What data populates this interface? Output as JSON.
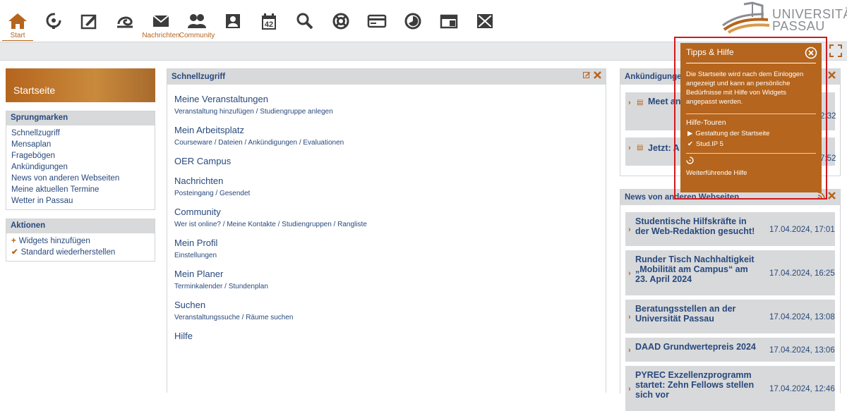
{
  "nav": {
    "items": [
      {
        "name": "start",
        "label": "Start",
        "icon": "home-icon"
      },
      {
        "name": "courses",
        "label": "",
        "icon": "seminar-icon"
      },
      {
        "name": "workplace",
        "label": "",
        "icon": "workplace-icon"
      },
      {
        "name": "oer",
        "label": "",
        "icon": "oer-icon"
      },
      {
        "name": "messages",
        "label": "Nachrichten",
        "icon": "mail-icon"
      },
      {
        "name": "community",
        "label": "Community",
        "icon": "community-icon"
      },
      {
        "name": "profile",
        "label": "",
        "icon": "person-icon"
      },
      {
        "name": "planer",
        "label": "",
        "icon": "calendar-icon"
      },
      {
        "name": "search",
        "label": "",
        "icon": "search-icon"
      },
      {
        "name": "tools",
        "label": "",
        "icon": "lifebuoy-icon"
      },
      {
        "name": "card",
        "label": "",
        "icon": "card-icon"
      },
      {
        "name": "stats",
        "label": "",
        "icon": "pie-icon"
      },
      {
        "name": "admin",
        "label": "",
        "icon": "window-icon"
      },
      {
        "name": "blubber",
        "label": "",
        "icon": "blocked-icon"
      }
    ],
    "calendar_day": "42"
  },
  "logo": {
    "line1": "UNIVERSITÄT",
    "line2": "PASSAU"
  },
  "sidebar": {
    "start_label": "Startseite",
    "jump_title": "Sprungmarken",
    "jump_items": [
      "Schnellzugriff",
      "Mensaplan",
      "Fragebögen",
      "Ankündigungen",
      "News von anderen Webseiten",
      "Meine aktuellen Termine",
      "Wetter in Passau"
    ],
    "actions_title": "Aktionen",
    "actions": [
      "Widgets hinzufügen",
      "Standard wiederherstellen"
    ]
  },
  "quick": {
    "title": "Schnellzugriff",
    "sections": [
      {
        "t": "Meine Veranstaltungen",
        "links": [
          "Veranstaltung hinzufügen",
          "Studiengruppe anlegen"
        ]
      },
      {
        "t": "Mein Arbeitsplatz",
        "links": [
          "Courseware",
          "Dateien",
          "Ankündigungen",
          "Evaluationen"
        ]
      },
      {
        "t": "OER Campus",
        "links": []
      },
      {
        "t": "Nachrichten",
        "links": [
          "Posteingang",
          "Gesendet"
        ]
      },
      {
        "t": "Community",
        "links": [
          "Wer ist online?",
          "Meine Kontakte",
          "Studiengruppen",
          "Rangliste"
        ]
      },
      {
        "t": "Mein Profil",
        "links": [
          "Einstellungen"
        ]
      },
      {
        "t": "Mein Planer",
        "links": [
          "Terminkalender",
          "Stundenplan"
        ]
      },
      {
        "t": "Suchen",
        "links": [
          "Veranstaltungssuche",
          "Räume suchen"
        ]
      },
      {
        "t": "Hilfe",
        "links": []
      }
    ]
  },
  "announcements": {
    "title": "Ankündigungen",
    "items": [
      {
        "title": "Meet anmeld",
        "date": "2:32"
      },
      {
        "title": "Jetzt: A",
        "date": "7:52"
      }
    ]
  },
  "news": {
    "title": "News von anderen Webseiten",
    "items": [
      {
        "title": "Studentische Hilfskräfte in der Web-Redaktion gesucht!",
        "date": "17.04.2024, 17:01"
      },
      {
        "title": "Runder Tisch Nachhaltigkeit „Mobilität am Campus“ am 23. April 2024",
        "date": "17.04.2024, 16:25"
      },
      {
        "title": "Beratungsstellen an der Universität Passau",
        "date": "17.04.2024, 13:08"
      },
      {
        "title": "DAAD Grundwertepreis 2024",
        "date": "17.04.2024, 13:06"
      },
      {
        "title": "PYREC Exzellenzprogramm startet: Zehn Fellows stellen sich vor",
        "date": "17.04.2024, 12:46"
      }
    ]
  },
  "help": {
    "title": "Tipps & Hilfe",
    "text": "Die Startseite wird nach dem Einloggen angezeigt und kann an persönliche Bedürfnisse mit Hilfe von Widgets angepasst werden.",
    "tours_title": "Hilfe-Touren",
    "tours": [
      "Gestaltung der Startseite",
      "Stud.IP 5"
    ],
    "more": "Weiterführende Hilfe"
  },
  "colors": {
    "accent": "#b5651d",
    "text": "#28497c",
    "header": "#d8d9db",
    "highlight": "#d0191f"
  }
}
